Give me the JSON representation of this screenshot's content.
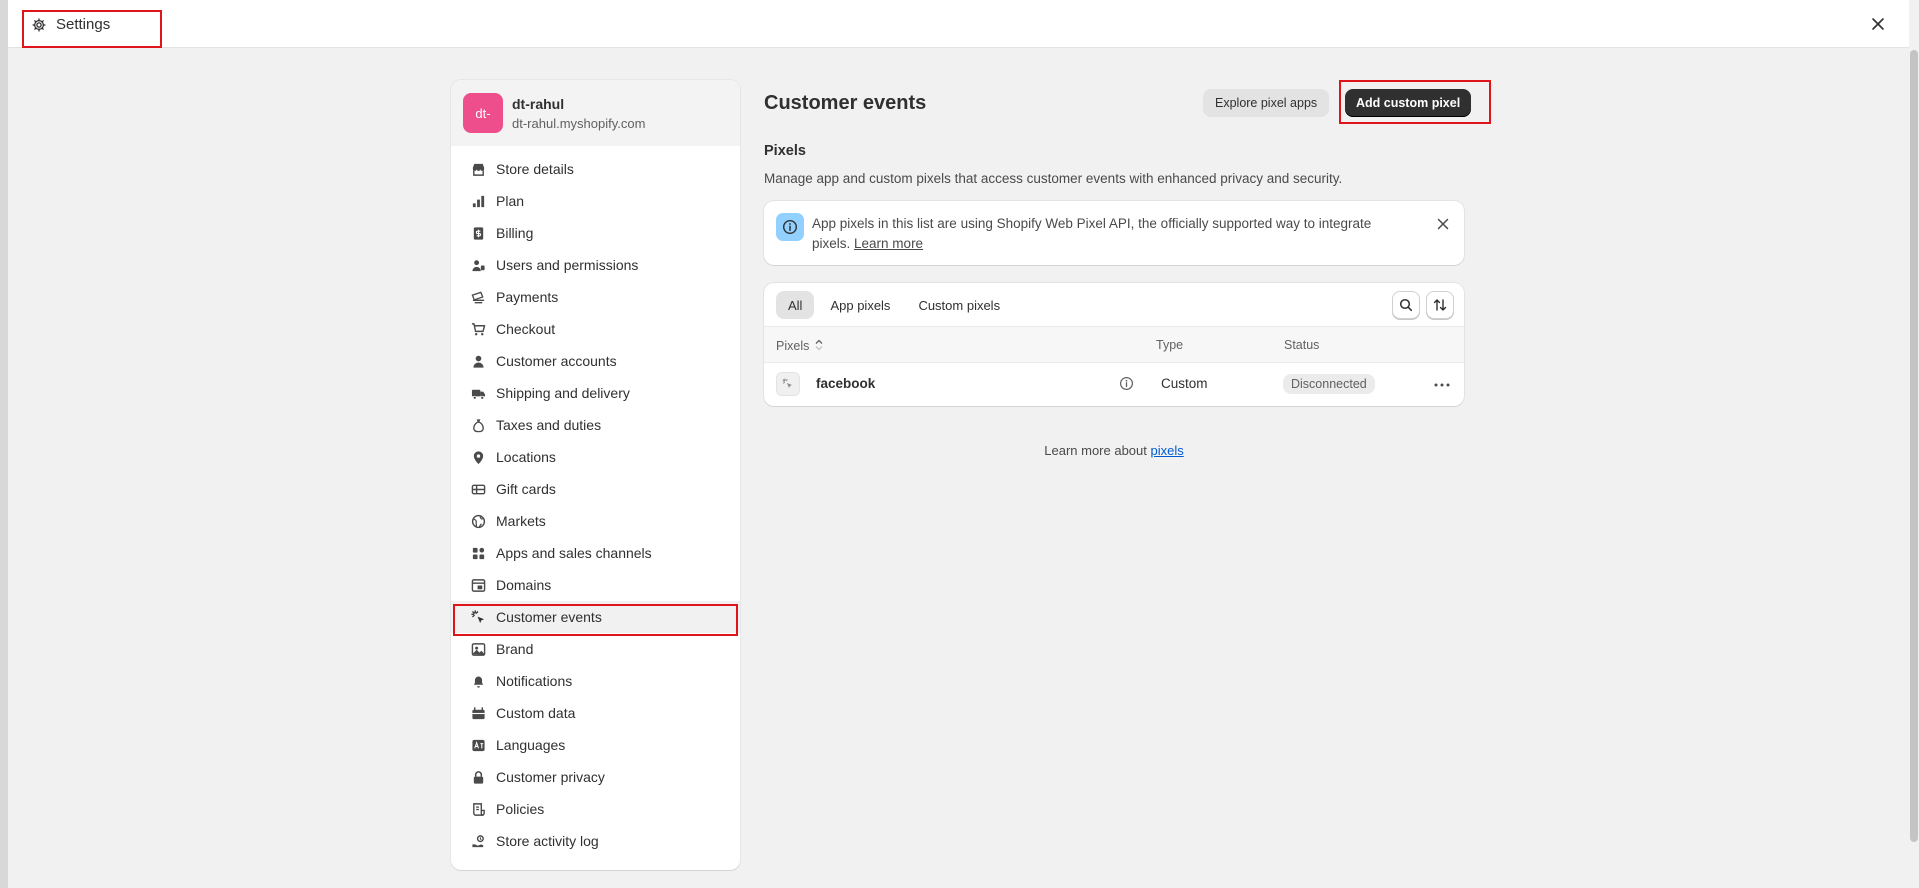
{
  "window": {
    "title": "Settings"
  },
  "store": {
    "avatar_text": "dt-",
    "name": "dt-rahul",
    "domain": "dt-rahul.myshopify.com"
  },
  "sidebar": {
    "items": [
      {
        "label": "Store details",
        "icon": "store-icon"
      },
      {
        "label": "Plan",
        "icon": "plan-icon"
      },
      {
        "label": "Billing",
        "icon": "billing-icon"
      },
      {
        "label": "Users and permissions",
        "icon": "users-icon"
      },
      {
        "label": "Payments",
        "icon": "payments-icon"
      },
      {
        "label": "Checkout",
        "icon": "cart-icon"
      },
      {
        "label": "Customer accounts",
        "icon": "person-icon"
      },
      {
        "label": "Shipping and delivery",
        "icon": "truck-icon"
      },
      {
        "label": "Taxes and duties",
        "icon": "money-bag-icon"
      },
      {
        "label": "Locations",
        "icon": "location-pin-icon"
      },
      {
        "label": "Gift cards",
        "icon": "gift-card-icon"
      },
      {
        "label": "Markets",
        "icon": "globe-icon"
      },
      {
        "label": "Apps and sales channels",
        "icon": "apps-icon"
      },
      {
        "label": "Domains",
        "icon": "domains-icon"
      },
      {
        "label": "Customer events",
        "icon": "cursor-click-icon",
        "active": true
      },
      {
        "label": "Brand",
        "icon": "brand-icon"
      },
      {
        "label": "Notifications",
        "icon": "bell-icon"
      },
      {
        "label": "Custom data",
        "icon": "custom-data-icon"
      },
      {
        "label": "Languages",
        "icon": "language-icon"
      },
      {
        "label": "Customer privacy",
        "icon": "lock-icon"
      },
      {
        "label": "Policies",
        "icon": "policies-icon"
      },
      {
        "label": "Store activity log",
        "icon": "activity-log-icon"
      }
    ]
  },
  "main": {
    "title": "Customer events",
    "explore_label": "Explore pixel apps",
    "add_label": "Add custom pixel",
    "section_title": "Pixels",
    "section_desc": "Manage app and custom pixels that access customer events with enhanced privacy and security.",
    "banner": {
      "text": "App pixels in this list are using Shopify Web Pixel API, the officially supported way to integrate pixels.",
      "link": "Learn more"
    },
    "tabs": [
      "All",
      "App pixels",
      "Custom pixels"
    ],
    "table": {
      "columns": [
        "Pixels",
        "Type",
        "Status"
      ],
      "rows": [
        {
          "name": "facebook",
          "type": "Custom",
          "status": "Disconnected"
        }
      ]
    },
    "footer_text": "Learn more about",
    "footer_link": "pixels"
  },
  "colors": {
    "accent_dark": "#303030",
    "avatar": "#ee4e8c",
    "info": "#91d0ff",
    "link": "#005bd3",
    "highlight": "#e0151b"
  }
}
